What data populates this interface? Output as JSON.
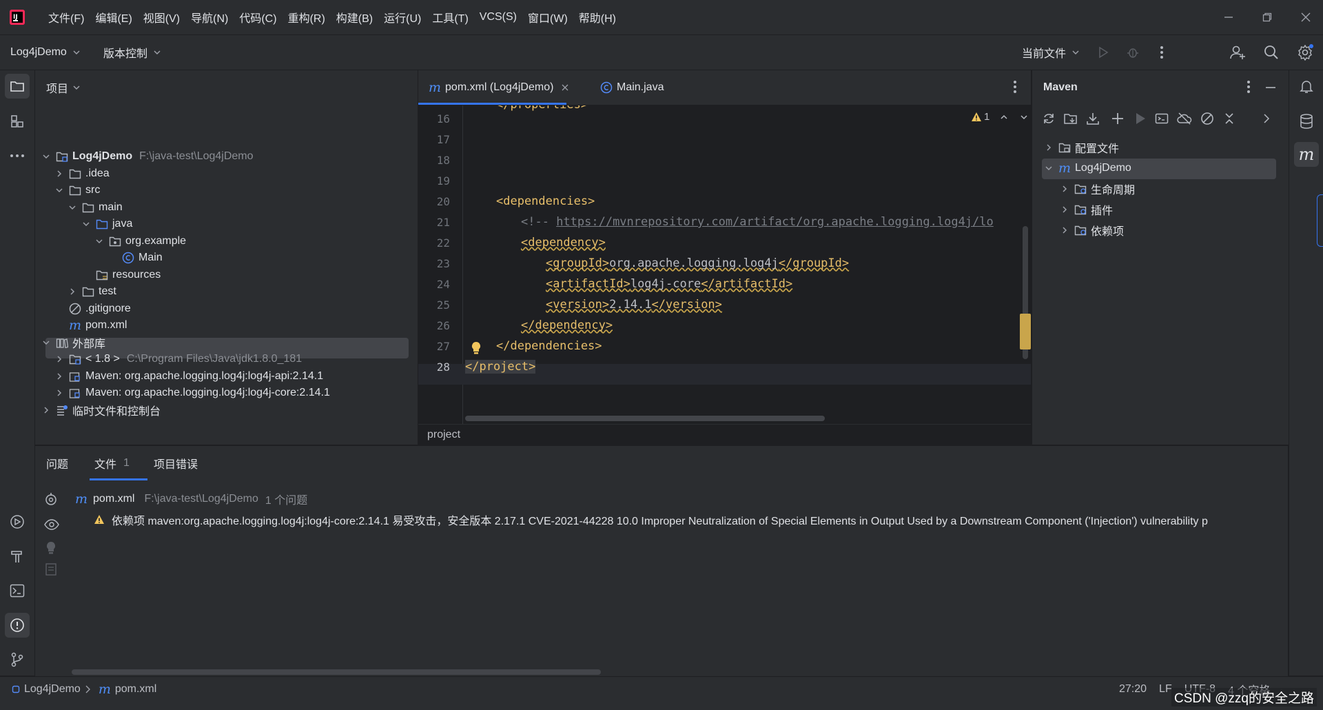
{
  "menu": [
    "文件(F)",
    "编辑(E)",
    "视图(V)",
    "导航(N)",
    "代码(C)",
    "重构(R)",
    "构建(B)",
    "运行(U)",
    "工具(T)",
    "VCS(S)",
    "窗口(W)",
    "帮助(H)"
  ],
  "toolbar": {
    "project_name": "Log4jDemo",
    "vcs_label": "版本控制",
    "run_config": "当前文件"
  },
  "project_panel": {
    "title": "项目",
    "tree": [
      {
        "label": "Log4jDemo",
        "hint": "F:\\java-test\\Log4jDemo",
        "icon": "module-folder-icon"
      },
      {
        "label": ".idea",
        "icon": "folder-icon"
      },
      {
        "label": "src",
        "icon": "folder-icon"
      },
      {
        "label": "main",
        "icon": "folder-icon"
      },
      {
        "label": "java",
        "icon": "source-folder-icon"
      },
      {
        "label": "org.example",
        "icon": "package-icon"
      },
      {
        "label": "Main",
        "icon": "class-icon"
      },
      {
        "label": "resources",
        "icon": "resources-folder-icon"
      },
      {
        "label": "test",
        "icon": "folder-icon"
      },
      {
        "label": ".gitignore",
        "icon": "ignore-file-icon"
      },
      {
        "label": "pom.xml",
        "icon": "maven-file-icon"
      },
      {
        "label": "外部库",
        "icon": "library-icon"
      },
      {
        "label": "< 1.8 >",
        "hint": "C:\\Program Files\\Java\\jdk1.8.0_181",
        "icon": "jdk-icon"
      },
      {
        "label": "Maven: org.apache.logging.log4j:log4j-api:2.14.1",
        "icon": "library-jar-icon"
      },
      {
        "label": "Maven: org.apache.logging.log4j:log4j-core:2.14.1",
        "icon": "library-jar-icon"
      },
      {
        "label": "临时文件和控制台",
        "icon": "scratches-icon"
      }
    ]
  },
  "editor": {
    "tabs": [
      {
        "label": "pom.xml (Log4jDemo)",
        "icon": "maven-file-icon",
        "active": true
      },
      {
        "label": "Main.java",
        "icon": "class-icon",
        "active": false
      }
    ],
    "warning_count": "1",
    "lines": [
      {
        "n": "16",
        "text": ""
      },
      {
        "n": "17",
        "text": ""
      },
      {
        "n": "18",
        "text": ""
      },
      {
        "n": "19",
        "text": ""
      },
      {
        "n": "20",
        "text": "<dependencies>"
      },
      {
        "n": "21",
        "text": "<!-- https://mvnrepository.com/artifact/org.apache.logging.log4j/lo"
      },
      {
        "n": "22",
        "text": "<dependency>"
      },
      {
        "n": "23",
        "text": "<groupId>org.apache.logging.log4j</groupId>"
      },
      {
        "n": "24",
        "text": "<artifactId>log4j-core</artifactId>"
      },
      {
        "n": "25",
        "text": "<version>2.14.1</version>"
      },
      {
        "n": "26",
        "text": "</dependency>"
      },
      {
        "n": "27",
        "text": "</dependencies>"
      },
      {
        "n": "28",
        "text": "</project>"
      }
    ],
    "partial_top": "</properties>",
    "breadcrumb": "project"
  },
  "maven": {
    "title": "Maven",
    "tree": [
      {
        "label": "配置文件",
        "icon": "profiles-folder-icon"
      },
      {
        "label": "Log4jDemo",
        "icon": "maven-project-icon"
      },
      {
        "label": "生命周期",
        "icon": "lifecycle-folder-icon"
      },
      {
        "label": "插件",
        "icon": "plugins-folder-icon"
      },
      {
        "label": "依赖项",
        "icon": "dependencies-folder-icon"
      }
    ]
  },
  "problems": {
    "tabs": [
      {
        "label": "问题"
      },
      {
        "label": "文件",
        "count": "1"
      },
      {
        "label": "项目错误"
      }
    ],
    "file": {
      "name": "pom.xml",
      "path": "F:\\java-test\\Log4jDemo",
      "count_text": "1 个问题"
    },
    "message": "依赖项 maven:org.apache.logging.log4j:log4j-core:2.14.1 易受攻击，安全版本 2.17.1 CVE-2021-44228 10.0 Improper Neutralization of Special Elements in Output Used by a Downstream Component ('Injection') vulnerability p"
  },
  "statusbar": {
    "project": "Log4jDemo",
    "file": "pom.xml",
    "position": "27:20",
    "line_sep": "LF",
    "encoding": "UTF-8",
    "indent": "4 个空格",
    "watermark": "CSDN @zzq的安全之路"
  },
  "colors": {
    "accent": "#3574f0",
    "tag": "#e8bf6a",
    "warning": "#e5c07b"
  }
}
